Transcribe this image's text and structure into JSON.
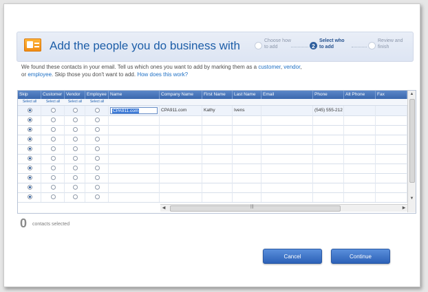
{
  "header": {
    "title": "Add the people you do business with",
    "icon": "contact-card-icon",
    "steps": [
      {
        "number": "",
        "line1": "Choose how",
        "line2": "to add",
        "active": false
      },
      {
        "number": "2",
        "line1": "Select who",
        "line2": "to add",
        "active": true
      },
      {
        "number": "",
        "line1": "Review and",
        "line2": "finish",
        "active": false
      }
    ]
  },
  "intro": {
    "part1": "We found these contacts in your email. Tell us which ones you want to add by marking them as a ",
    "customer": "customer",
    "sep1": ", ",
    "vendor": "vendor",
    "sep2": ",",
    "part2": "or ",
    "employee": "employee",
    "part3": ". Skip those you don't want to add. ",
    "help_link": "How does this work?"
  },
  "grid": {
    "columns": [
      "Skip",
      "Customer",
      "Vendor",
      "Employee",
      "Name",
      "Company Name",
      "First Name",
      "Last Name",
      "Email",
      "Phone",
      "Alt Phone",
      "Fax"
    ],
    "select_all": [
      "Select all",
      "Select all",
      "Select all",
      "Select all"
    ],
    "rows": [
      {
        "skip": true,
        "name": "CPA911.com",
        "company": "CPA911.com",
        "first": "Kathy",
        "last": "Ivens",
        "email": "",
        "phone": "(545) 555-212",
        "alt": "",
        "fax": ""
      },
      {
        "skip": true,
        "name": "",
        "company": "",
        "first": "",
        "last": "",
        "email": "",
        "phone": "",
        "alt": "",
        "fax": ""
      },
      {
        "skip": true,
        "name": "",
        "company": "",
        "first": "",
        "last": "",
        "email": "",
        "phone": "",
        "alt": "",
        "fax": ""
      },
      {
        "skip": true,
        "name": "",
        "company": "",
        "first": "",
        "last": "",
        "email": "",
        "phone": "",
        "alt": "",
        "fax": ""
      },
      {
        "skip": true,
        "name": "",
        "company": "",
        "first": "",
        "last": "",
        "email": "",
        "phone": "",
        "alt": "",
        "fax": ""
      },
      {
        "skip": true,
        "name": "",
        "company": "",
        "first": "",
        "last": "",
        "email": "",
        "phone": "",
        "alt": "",
        "fax": ""
      },
      {
        "skip": true,
        "name": "",
        "company": "",
        "first": "",
        "last": "",
        "email": "",
        "phone": "",
        "alt": "",
        "fax": ""
      },
      {
        "skip": true,
        "name": "",
        "company": "",
        "first": "",
        "last": "",
        "email": "",
        "phone": "",
        "alt": "",
        "fax": ""
      },
      {
        "skip": true,
        "name": "",
        "company": "",
        "first": "",
        "last": "",
        "email": "",
        "phone": "",
        "alt": "",
        "fax": ""
      },
      {
        "skip": true,
        "name": "",
        "company": "",
        "first": "",
        "last": "",
        "email": "",
        "phone": "",
        "alt": "",
        "fax": ""
      }
    ]
  },
  "status": {
    "count": "0",
    "label": "contacts selected"
  },
  "buttons": {
    "cancel": "Cancel",
    "continue": "Continue"
  },
  "colors": {
    "accent": "#1d5ea8",
    "header_bar": "#3a67ad",
    "button": "#2c61b7"
  }
}
